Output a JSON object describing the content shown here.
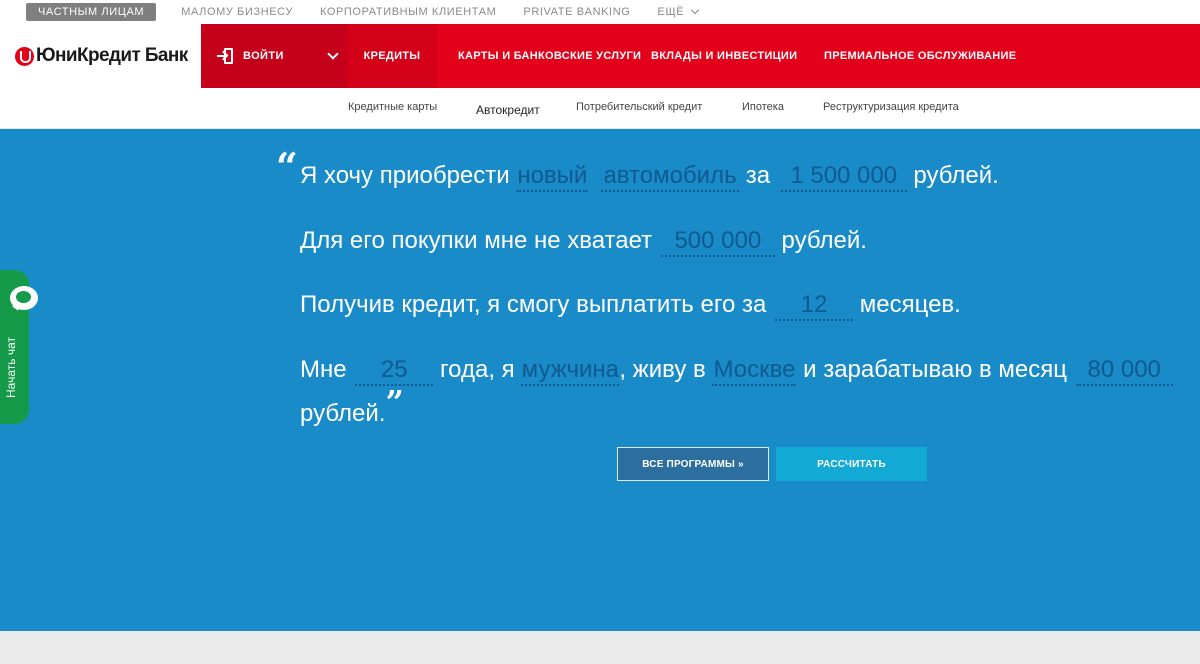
{
  "topbar": {
    "segments": [
      "ЧАСТНЫМ ЛИЦАМ",
      "МАЛОМУ БИЗНЕСУ",
      "КОРПОРАТИВНЫМ КЛИЕНТАМ",
      "PRIVATE BANKING",
      "ЕЩЁ"
    ]
  },
  "brand": {
    "name": "ЮниКредит Банк",
    "color": "#e2001a"
  },
  "login": {
    "label": "ВОЙТИ"
  },
  "nav": {
    "items": [
      "КРЕДИТЫ",
      "КАРТЫ И БАНКОВСКИЕ УСЛУГИ",
      "ВКЛАДЫ И ИНВЕСТИЦИИ",
      "ПРЕМИАЛЬНОЕ ОБСЛУЖИВАНИЕ"
    ],
    "active": "КРЕДИТЫ"
  },
  "subnav": {
    "items": [
      "Кредитные карты",
      "Автокредит",
      "Потребительский кредит",
      "Ипотека",
      "Реструктуризация кредита"
    ],
    "active": "Автокредит"
  },
  "form": {
    "quote_open": "“",
    "quote_close": "”",
    "line1": {
      "t1": "Я хочу приобрести",
      "f1": "новый",
      "f2": "автомобиль",
      "t2": "за",
      "f3": "1 500 000",
      "t3": "рублей",
      "t4": "."
    },
    "line2": {
      "t1": "Для его покупки мне не хватает",
      "f1": "500 000",
      "t2": "рублей",
      "t3": "."
    },
    "line3": {
      "t1": "Получив кредит, я смогу выплатить его за",
      "f1": "12",
      "t2": "месяцев",
      "t3": "."
    },
    "line4": {
      "t1": "Мне",
      "f1": "25",
      "t2": "года, я",
      "f2": "мужчина",
      "t3": ", живу в",
      "f3": "Москве",
      "t4": "и зарабатываю в месяц",
      "f4": "80 000"
    },
    "line5": {
      "t1": "рублей",
      "t2": "."
    }
  },
  "buttons": {
    "programs": "ВСЕ ПРОГРАММЫ »",
    "calculate": "РАССЧИТАТЬ"
  },
  "chat": {
    "label": "Начать чат",
    "icon": "chat-bubble-icon",
    "color": "#159a4a"
  },
  "colors": {
    "hero_bg": "#1a8bc9",
    "field_text": "#0f5a8e",
    "calc_button": "#12a9d5"
  }
}
